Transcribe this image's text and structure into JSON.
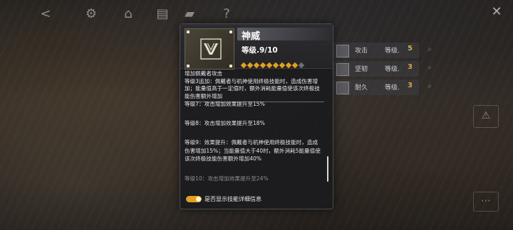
{
  "topbar": {
    "icons": [
      "back-icon",
      "gear-icon",
      "hanger-icon",
      "document-icon",
      "car-icon",
      "help-icon"
    ]
  },
  "dialog": {
    "item_name": "神威",
    "level": "等级.9/10",
    "stars_filled": 9,
    "stars_total": 10,
    "base_desc": [
      "增加佩戴者攻击",
      "等级3追加：佩戴者与机神使用终极技能时，造成伤害增加；能量值高于一定值时，额外消耗能量值使该次终极技能伤害额外增加"
    ],
    "levels": [
      {
        "text": "等级7：攻击增加效果提升至15%",
        "dim": false
      },
      {
        "text": "等级8：攻击增加效果提升至18%",
        "dim": false
      },
      {
        "text": "等级9：效果提升：佩戴者与机神使用终极技能时，造成伤害增加15%；当能量值大于40时，额外消耗5能量值使该次终极技能伤害额外增加40%",
        "dim": false
      },
      {
        "text": "等级10：攻击增加效果提升至24%",
        "dim": true
      }
    ],
    "toggle_label": "是否显示技能详细信息",
    "toggle_on": true
  },
  "stats": [
    {
      "label": "攻击",
      "level_label": "等级.",
      "level": "5"
    },
    {
      "label": "坚韧",
      "level_label": "等级.",
      "level": "3"
    },
    {
      "label": "耐久",
      "level_label": "等级.",
      "level": "3"
    }
  ],
  "colors": {
    "accent": "#e0a21a",
    "panel": "#1c1c1f"
  }
}
